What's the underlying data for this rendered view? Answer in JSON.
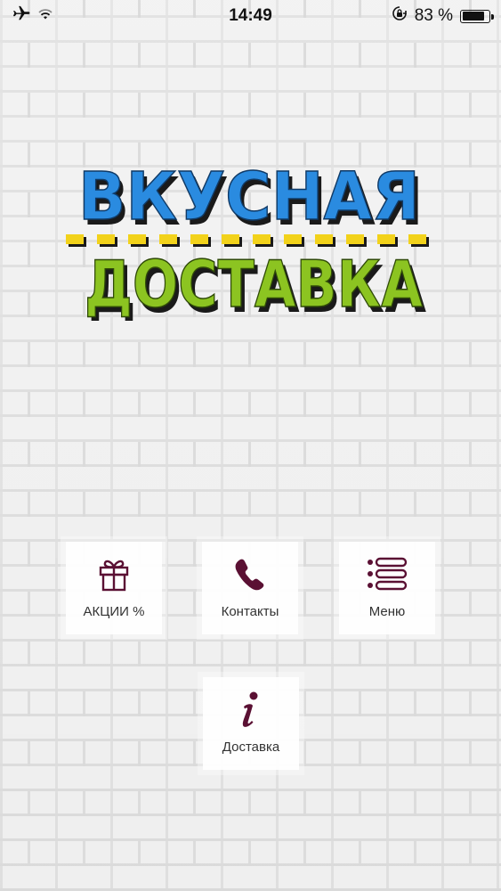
{
  "status_bar": {
    "time": "14:49",
    "battery_percent_text": "83 %",
    "battery_level": 0.83,
    "icons": [
      "airplane-icon",
      "wifi-icon",
      "rotation-lock-icon",
      "battery-icon"
    ]
  },
  "logo": {
    "line1": "ВКУСНАЯ",
    "line2": "ДОСТАВКА",
    "colors": {
      "line1": "#2a8be0",
      "line2": "#8cc421",
      "dashes": "#f2d21b",
      "shadow": "#1a1a1a"
    }
  },
  "menu": {
    "items": [
      {
        "label": "АКЦИИ %",
        "icon": "gift-icon"
      },
      {
        "label": "Контакты",
        "icon": "phone-icon"
      },
      {
        "label": "Меню",
        "icon": "list-icon"
      },
      {
        "label": "Доставка",
        "icon": "info-icon"
      }
    ],
    "icon_color": "#5a1033"
  }
}
